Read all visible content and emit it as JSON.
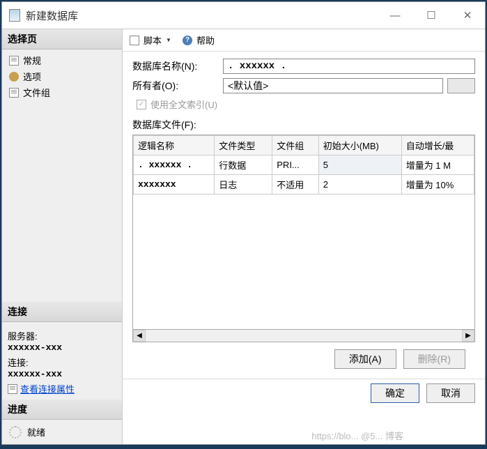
{
  "window": {
    "title": "新建数据库"
  },
  "sidebar": {
    "select_page": "选择页",
    "items": [
      {
        "label": "常规"
      },
      {
        "label": "选项"
      },
      {
        "label": "文件组"
      }
    ],
    "connection": {
      "header": "连接",
      "server_label": "服务器:",
      "server_value": "xxxxxx-xxx",
      "conn_label": "连接:",
      "conn_value": "xxxxxx-xxx",
      "view_props": "查看连接属性"
    },
    "progress": {
      "header": "进度",
      "status": "就绪"
    }
  },
  "toolbar": {
    "script": "脚本",
    "help": "帮助"
  },
  "form": {
    "db_name_label": "数据库名称(N):",
    "db_name_value": ". xxxxxx .",
    "owner_label": "所有者(O):",
    "owner_value": "<默认值>",
    "fulltext": "使用全文索引(U)",
    "files_label": "数据库文件(F):"
  },
  "table": {
    "headers": [
      "逻辑名称",
      "文件类型",
      "文件组",
      "初始大小(MB)",
      "自动增长/最"
    ],
    "rows": [
      {
        "c0": ". xxxxxx .",
        "c1": "行数据",
        "c2": "PRI...",
        "c3": "5",
        "c4": "增量为 1 M"
      },
      {
        "c0": "xxxxxxx",
        "c1": "日志",
        "c2": "不适用",
        "c3": "2",
        "c4": "增量为 10%"
      }
    ]
  },
  "buttons": {
    "add": "添加(A)",
    "remove": "删除(R)",
    "ok": "确定",
    "cancel": "取消"
  },
  "watermark": "https://blo... @5... 博客"
}
